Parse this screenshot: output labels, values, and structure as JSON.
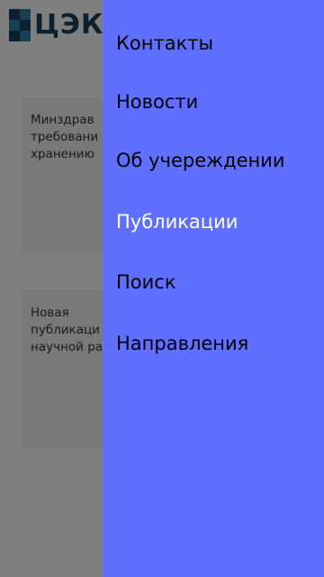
{
  "header": {
    "logo_text": "ЦЭККМ"
  },
  "cards": [
    {
      "lines": [
        "Минздрав",
        "требовани",
        "хранению"
      ]
    },
    {
      "lines": [
        "Новая",
        "публикаци",
        "научной ра"
      ]
    }
  ],
  "drawer": {
    "background_color": "#5f6fff",
    "items": [
      {
        "label": "Контакты",
        "color": "#000000"
      },
      {
        "label": "Новости",
        "color": "#000000"
      },
      {
        "label": "Об учереждении",
        "color": "#000000"
      },
      {
        "label": "Публикации",
        "color": "#ffffff"
      },
      {
        "label": "Поиск",
        "color": "#000000"
      },
      {
        "label": "Направления",
        "color": "#000000"
      }
    ]
  },
  "colors": {
    "overlay": "rgba(0,0,0,0.5)",
    "logo_dark": "#1d3e5a",
    "logo_teal": "#2e7ea6"
  }
}
